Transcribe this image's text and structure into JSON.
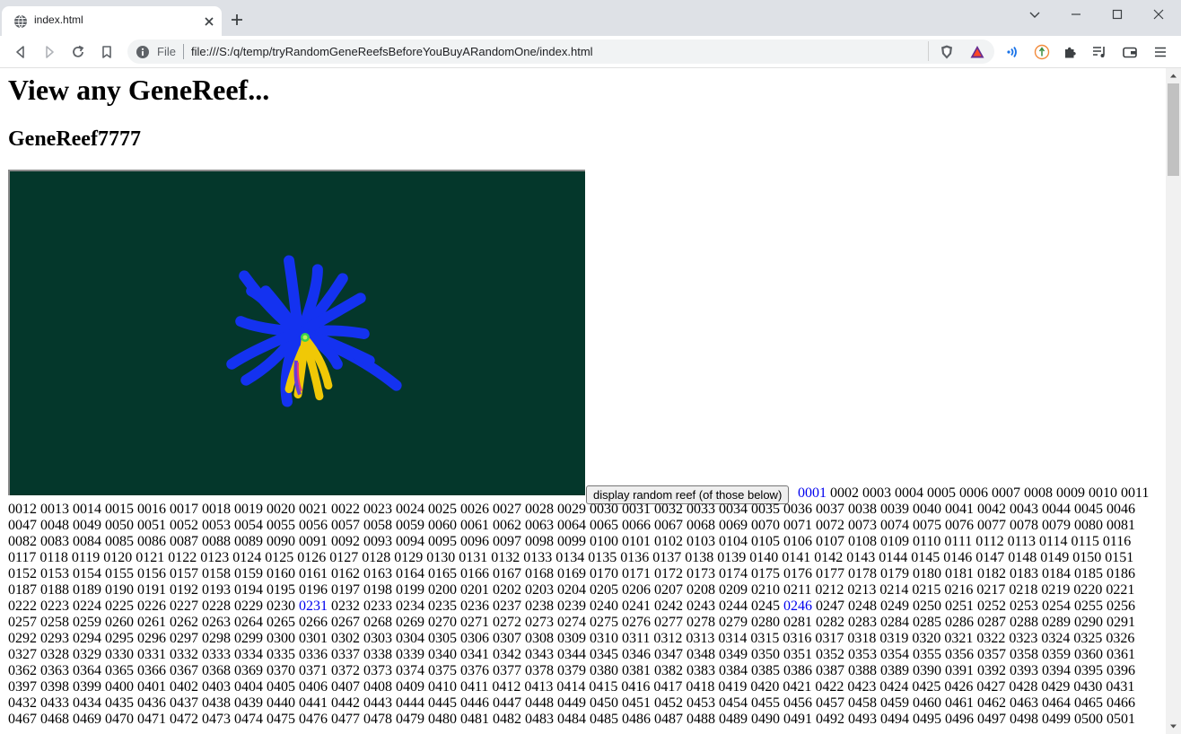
{
  "browser": {
    "tab_title": "index.html",
    "omnibox": {
      "scheme_label": "File",
      "url": "file:///S:/q/temp/tryRandomGeneReefsBeforeYouBuyARandomOne/index.html"
    },
    "icons": [
      "globe-icon",
      "close-icon",
      "plus-icon",
      "chevron-down-icon",
      "minimize-icon",
      "maximize-icon",
      "window-close-icon",
      "back-icon",
      "forward-icon",
      "reload-icon",
      "bookmark-icon",
      "info-icon",
      "brave-shield-icon",
      "brave-rewards-icon",
      "wifi-icon",
      "extension-icon",
      "puzzle-icon",
      "media-icon",
      "wallet-icon",
      "menu-icon"
    ]
  },
  "page": {
    "heading": "View any GeneReef...",
    "reef_title": "GeneReef7777",
    "random_button_label": "display random reef (of those below)",
    "canvas_background": "#04372b",
    "link_color": "#0000ee",
    "highlighted_ids": [
      "0001",
      "0231",
      "0246"
    ],
    "first_id": 1,
    "last_id": 501
  }
}
